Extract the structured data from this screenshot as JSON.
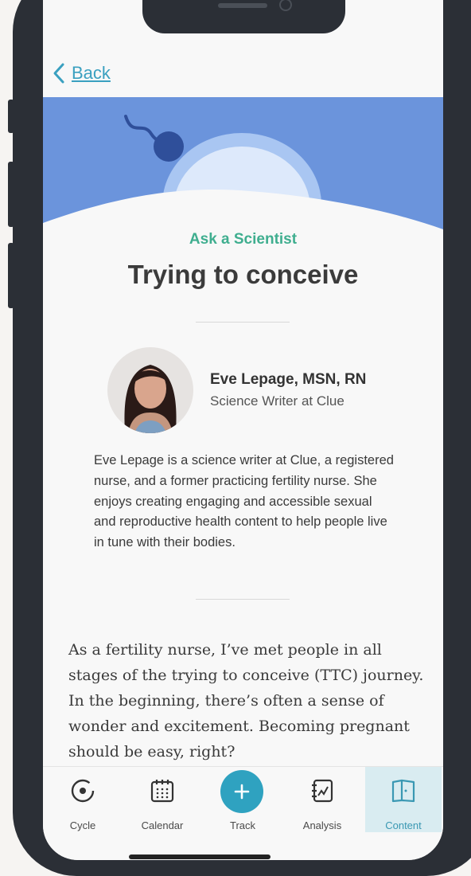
{
  "nav": {
    "back_label": "Back"
  },
  "header": {
    "eyebrow": "Ask a Scientist",
    "title": "Trying to conceive"
  },
  "author": {
    "name": "Eve Lepage, MSN, RN",
    "role": "Science Writer at Clue",
    "bio": "Eve Lepage is a science writer at Clue, a registered nurse, and a former practicing fertility nurse. She enjoys creating engaging and accessible sexual and reproductive health content to help people live in tune with their bodies."
  },
  "article": {
    "intro": "As a fertility nurse, I’ve met people in all stages of the trying to conceive (TTC) journey. In the beginning, there’s often a sense of wonder and excitement. Becoming pregnant should be easy, right?"
  },
  "tabbar": {
    "tabs": [
      {
        "label": "Cycle",
        "icon": "cycle-icon"
      },
      {
        "label": "Calendar",
        "icon": "calendar-icon"
      },
      {
        "label": "Track",
        "icon": "plus-icon"
      },
      {
        "label": "Analysis",
        "icon": "analysis-icon"
      },
      {
        "label": "Content",
        "icon": "book-icon",
        "active": true
      }
    ]
  },
  "colors": {
    "accent": "#3aa0c0",
    "eyebrow": "#3fae8f",
    "hero_blue": "#6b94dc",
    "track_button": "#2fa2c0",
    "active_tab_bg": "#d9ecf1"
  }
}
